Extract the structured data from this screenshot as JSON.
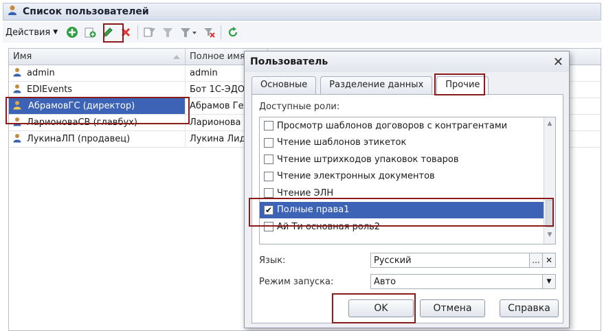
{
  "window": {
    "title": "Список пользователей"
  },
  "toolbar": {
    "actions_label": "Действия"
  },
  "grid": {
    "columns": [
      "Имя",
      "Полное имя"
    ],
    "rows": [
      {
        "name": "admin",
        "full": "admin"
      },
      {
        "name": "EDIEvents",
        "full": "Бот 1С-ЭДО"
      },
      {
        "name": "АбрамовГС (директор)",
        "full": "Абрамов Ге"
      },
      {
        "name": "ЛарионоваСВ (главбух)",
        "full": "Ларионова"
      },
      {
        "name": "ЛукинаЛП (продавец)",
        "full": "Лукина Лид"
      }
    ]
  },
  "dialog": {
    "title": "Пользователь",
    "close_glyph": "✕",
    "tabs": [
      "Основные",
      "Разделение данных",
      "Прочие"
    ],
    "roles_label": "Доступные роли:",
    "roles": [
      {
        "label": "Просмотр шаблонов договоров с контрагентами",
        "checked": false
      },
      {
        "label": "Чтение шаблонов этикеток",
        "checked": false
      },
      {
        "label": "Чтение штрихкодов упаковок товаров",
        "checked": false
      },
      {
        "label": "Чтение электронных документов",
        "checked": false
      },
      {
        "label": "Чтение ЭЛН",
        "checked": false
      },
      {
        "label": "Полные права1",
        "checked": true
      },
      {
        "label": "Ай Ти основная роль2",
        "checked": false
      }
    ],
    "language_label": "Язык:",
    "language_value": "Русский",
    "language_dots": "...",
    "language_clear": "✕",
    "mode_label": "Режим запуска:",
    "mode_value": "Авто",
    "mode_arrow": "▼",
    "check_mark": "✔",
    "ok_label": "OK",
    "cancel_label": "Отмена",
    "help_label": "Справка"
  },
  "colors": {
    "selection": "#3c63b5",
    "highlight_box": "#8b1a1a"
  }
}
